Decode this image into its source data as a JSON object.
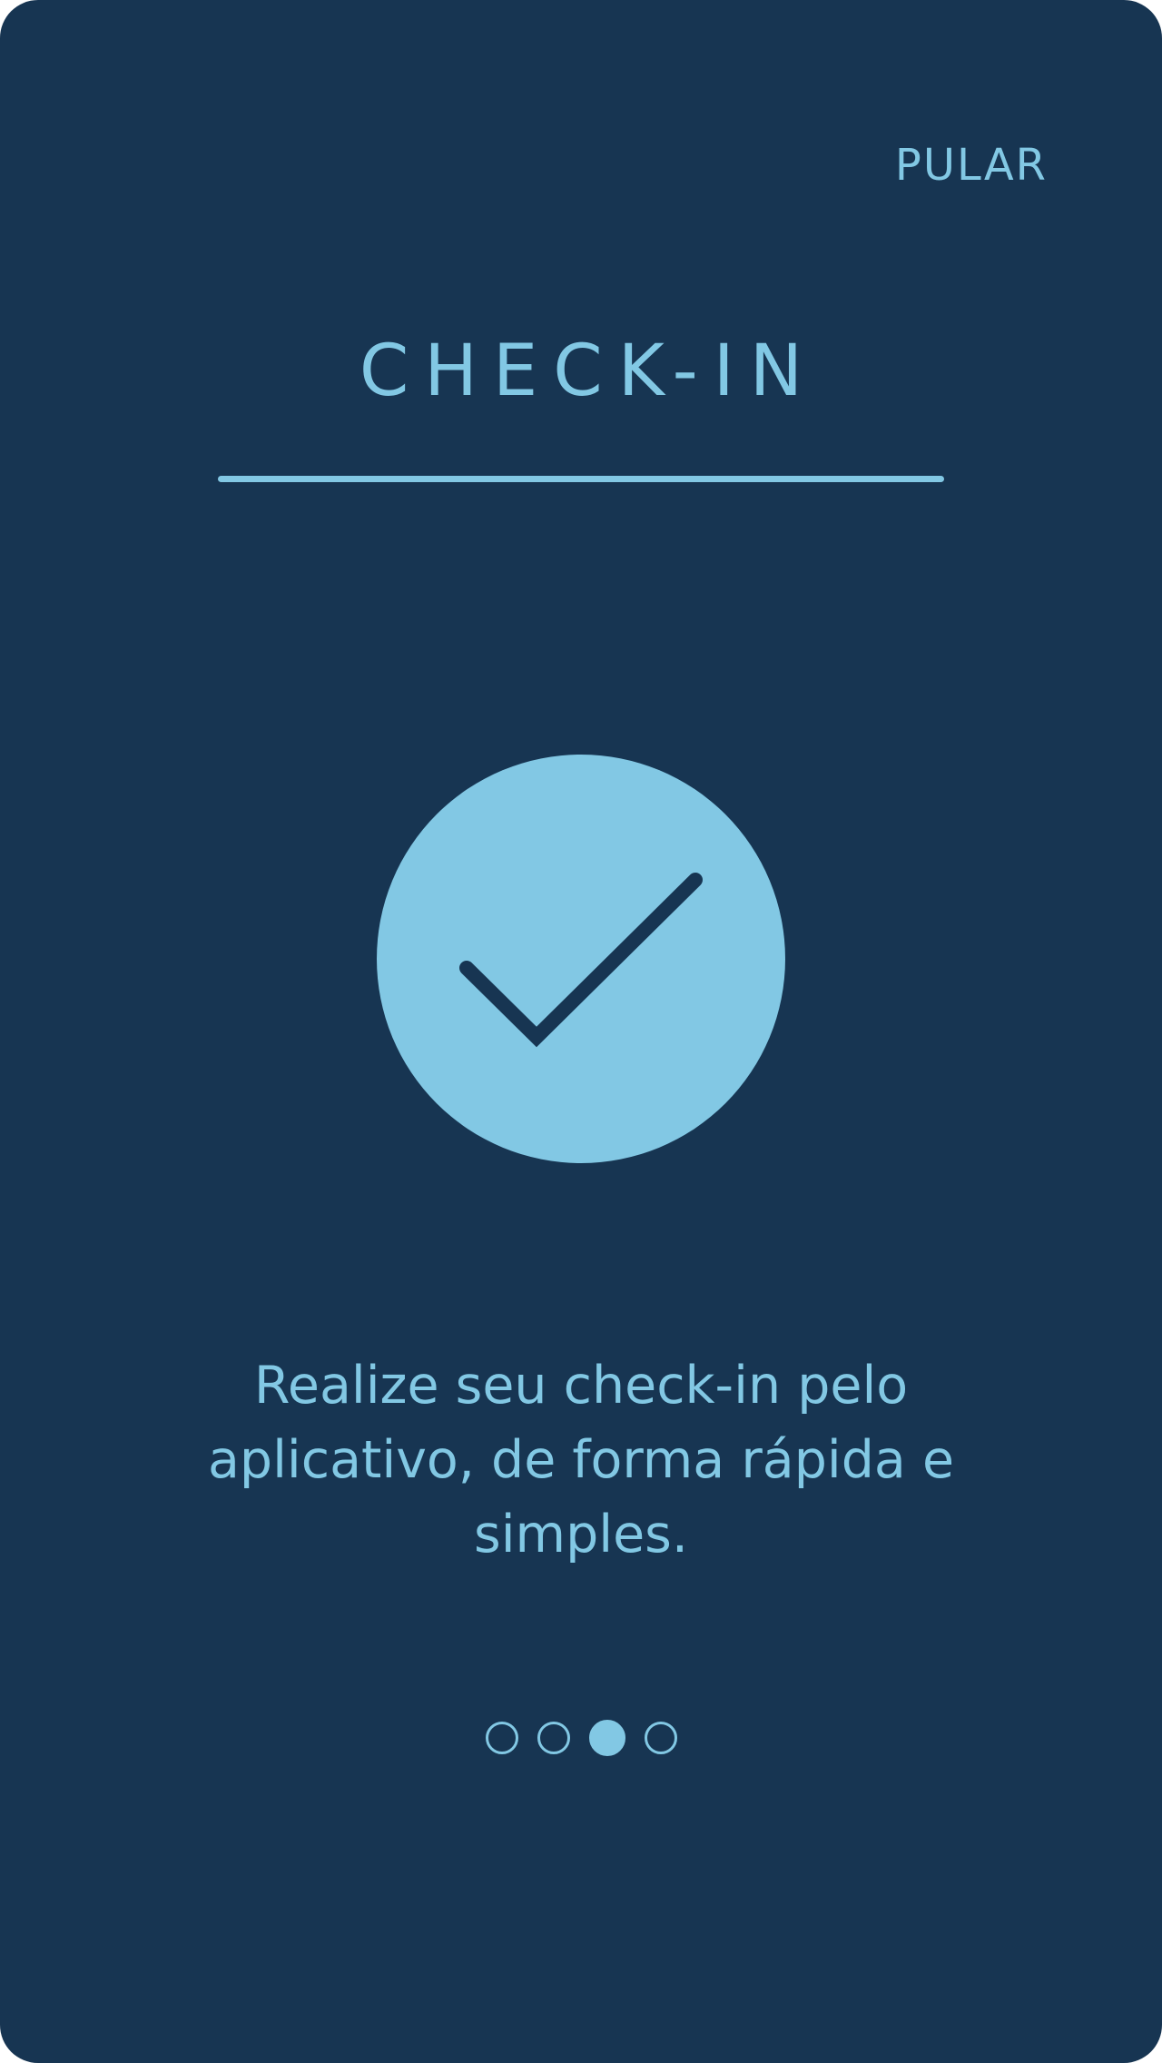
{
  "skip_label": "PULAR",
  "title": "CHECK-IN",
  "hero_icon": "check-circle-icon",
  "description": "Realize seu check-in pelo aplicativo, de forma rápida e simples.",
  "pagination": {
    "total": 4,
    "active_index": 2
  },
  "colors": {
    "background": "#173552",
    "accent": "#82c8e4"
  }
}
